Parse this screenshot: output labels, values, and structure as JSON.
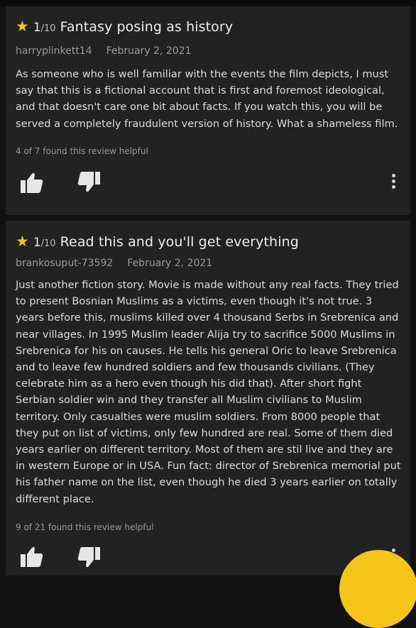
{
  "reviews": [
    {
      "rating": "1",
      "rating_max": "/10",
      "title": "Fantasy posing as history",
      "author": "harryplinkett14",
      "date": "February 2, 2021",
      "body": "As someone who is well familiar with the events the film depicts, I must say that this is a fictional account that is first and foremost ideological, and that doesn't care one bit about facts. If you watch this, you will be served a completely fraudulent version of history. What a shameless film.",
      "helpful": "4 of 7 found this review helpful"
    },
    {
      "rating": "1",
      "rating_max": "/10",
      "title": "Read this and you'll get everything",
      "author": "brankosuput-73592",
      "date": "February 2, 2021",
      "body": "Just another fiction story. Movie is made without any real facts. They tried to present Bosnian Muslims as a victims, even though it's not true. 3 years before this, muslims killed over 4 thousand Serbs in Srebrenica and near villages. In 1995 Muslim leader Alija try to sacrifice 5000 Muslims in Srebrenica for his on causes. He tells his general Oric to leave Srebrenica and to leave few hundred soldiers and few thousands civilians. (They celebrate him as a hero even though his did that). After short fight Serbian soldier win and they transfer all Muslim civilians to Muslim territory. Only casualties were muslim soldiers. From 8000 people that they put on list of victims, only few hundred are real. Some of them died years earlier on different territory. Most of them are stil live and they are in western Europe or in USA. Fun fact: director of Srebrenica memorial put his father name on the list, even though he died 3 years earlier on totally different place.",
      "helpful": "9 of 21 found this review helpful"
    }
  ],
  "icons": {
    "star": "star-icon",
    "thumbs_up": "thumbs-up-icon",
    "thumbs_down": "thumbs-down-icon",
    "more": "more-vertical-icon"
  },
  "colors": {
    "star": "#f5c518",
    "card": "#222222",
    "background": "#111111"
  }
}
